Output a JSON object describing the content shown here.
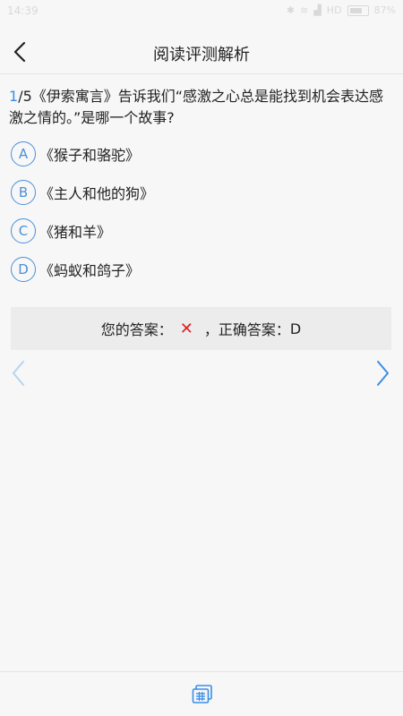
{
  "status_bar": {
    "time": "14:39",
    "network": "HD",
    "battery": "87%"
  },
  "header": {
    "title": "阅读评测解析",
    "back_icon": "chevron-left-icon"
  },
  "question": {
    "number": "1",
    "total_suffix": "/5",
    "text": "《伊索寓言》告诉我们“感激之心总是能找到机会表达感激之情的。”是哪一个故事?"
  },
  "options": [
    {
      "letter": "A",
      "text": "《猴子和骆驼》"
    },
    {
      "letter": "B",
      "text": "《主人和他的狗》"
    },
    {
      "letter": "C",
      "text": "《猪和羊》"
    },
    {
      "letter": "D",
      "text": "《蚂蚁和鸽子》"
    }
  ],
  "answer": {
    "your_label": "您的答案：",
    "your_mark": "✕",
    "correct_label": "，正确答案：",
    "correct_value": "D"
  },
  "colors": {
    "accent": "#3a8ee6",
    "option_border": "#4a90d9",
    "wrong": "#e02020",
    "prev_disabled": "#b7d4ee",
    "next_active": "#3a8ee6"
  },
  "bottom_bar": {
    "icon": "answer-card-icon"
  }
}
